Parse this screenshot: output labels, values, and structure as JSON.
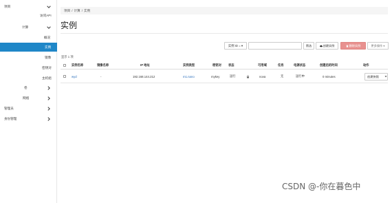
{
  "sidebar": {
    "items": [
      {
        "label": "项目",
        "chevron": "down"
      },
      {
        "label": "访问API",
        "chevron": ""
      },
      {
        "label": "计算",
        "chevron": "down"
      },
      {
        "label": "概况",
        "chevron": ""
      },
      {
        "label": "实例",
        "chevron": "",
        "active": true
      },
      {
        "label": "镜像",
        "chevron": ""
      },
      {
        "label": "密钥对",
        "chevron": ""
      },
      {
        "label": "主机组",
        "chevron": ""
      },
      {
        "label": "卷",
        "chevron": "right"
      },
      {
        "label": "网络",
        "chevron": "right"
      },
      {
        "label": "管理员",
        "chevron": "right"
      },
      {
        "label": "身份管理",
        "chevron": "right"
      }
    ]
  },
  "breadcrumb": [
    "项目",
    "/",
    "计算",
    "/",
    "实例"
  ],
  "page_title": "实例",
  "toolbar": {
    "filter_select": "实例 ID = ▾",
    "filter_input_value": "",
    "filter_button": "筛选",
    "create_button": "创建实例",
    "delete_button": "删除实例",
    "more_button": "更多操作 ▾"
  },
  "count_text": "显示 1 项",
  "table": {
    "headers": [
      "实例名称",
      "镜像名称",
      "IP 地址",
      "实例类型",
      "密钥对",
      "状态",
      "",
      "可用域",
      "任务",
      "电源状态",
      "创建后的时间",
      "动作"
    ],
    "rows": [
      {
        "name": "wyd",
        "image": "-",
        "ip": "192.168.144.212",
        "flavor": "m1.nano",
        "keypair": "mykey",
        "status": "运行",
        "status_icon": "lock-icon",
        "zone": "nova",
        "task": "无",
        "power": "运行中",
        "age": "0 minutes",
        "action": "创建快照"
      }
    ]
  },
  "watermark": "CSDN @-你在暮色中",
  "colors": {
    "active_nav": "#1f87c8",
    "delete_button": "#e8918f",
    "link": "#2a6ebb"
  }
}
